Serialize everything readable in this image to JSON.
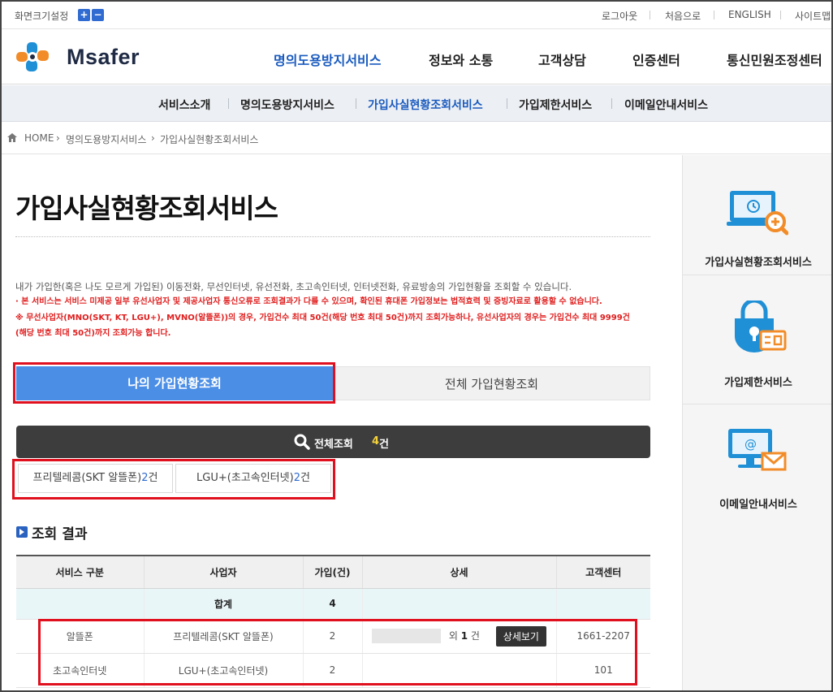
{
  "topbar": {
    "fontsize_label": "화면크기설정",
    "plus": "+",
    "minus": "−",
    "links": [
      "로그아웃",
      "처음으로",
      "ENGLISH",
      "사이트맵"
    ]
  },
  "header": {
    "logo_text": "Msafer",
    "gnb": [
      "명의도용방지서비스",
      "정보와 소통",
      "고객상담",
      "인증센터",
      "통신민원조정센터"
    ]
  },
  "subnav": [
    "서비스소개",
    "명의도용방지서비스",
    "가입사실현황조회서비스",
    "가입제한서비스",
    "이메일안내서비스"
  ],
  "breadcrumb": [
    "HOME",
    "명의도용방지서비스",
    "가입사실현황조회서비스"
  ],
  "main": {
    "title": "가입사실현황조회서비스",
    "desc": "내가 가입한(혹은 나도 모르게 가입된) 이동전화, 무선인터넷, 유선전화, 초고속인터넷, 인터넷전화, 유료방송의 가입현황을 조회할 수 있습니다.",
    "notice1": "· 본 서비스는 서비스 미제공 일부 유선사업자 및 제공사업자 통신오류로 조회결과가 다를 수 있으며, 확인된 휴대폰 가입정보는 법적효력 및 증빙자료로 활용할 수 없습니다.",
    "notice2": "※ 무선사업자(MNO(SKT, KT, LGU+), MVNO(알뜰폰))의 경우, 가입건수 최대 50건(해당 번호 최대 50건)까지 조회가능하나, 유선사업자의 경우는 가입건수 최대 9999건",
    "notice3": "(해당 번호 최대 50건)까지 조회가능 합니다.",
    "tab_mine": "나의 가입현황조회",
    "tab_all": "전체 가입현황조회",
    "search_label": "전체조회",
    "search_count": "4",
    "search_unit": "건",
    "chips": [
      {
        "label": "프리텔레콤(SKT 알뜰폰)",
        "count": "2",
        "unit": "건"
      },
      {
        "label": "LGU+(초고속인터넷)",
        "count": "2",
        "unit": "건"
      }
    ],
    "result_title": "조회 결과"
  },
  "table": {
    "headers": [
      "서비스 구분",
      "사업자",
      "가입(건)",
      "상세",
      "고객센터"
    ],
    "total_label": "합계",
    "total_value": "4",
    "rows": [
      {
        "service": "알뜰폰",
        "provider": "프리텔레콤(SKT 알뜰폰)",
        "count": "2",
        "detail_prefix": "외",
        "detail_num": "1",
        "detail_suffix": "건",
        "detail_button": "상세보기",
        "center": "1661-2207"
      },
      {
        "service": "초고속인터넷",
        "provider": "LGU+(초고속인터넷)",
        "count": "2",
        "center": "101"
      }
    ]
  },
  "sidebar": [
    "가입사실현황조회서비스",
    "가입제한서비스",
    "이메일안내서비스"
  ],
  "colors": {
    "accent": "#1a5bbf",
    "tab": "#4b8ee6",
    "highlight": "#e0101e",
    "dark": "#3d3d3d"
  }
}
